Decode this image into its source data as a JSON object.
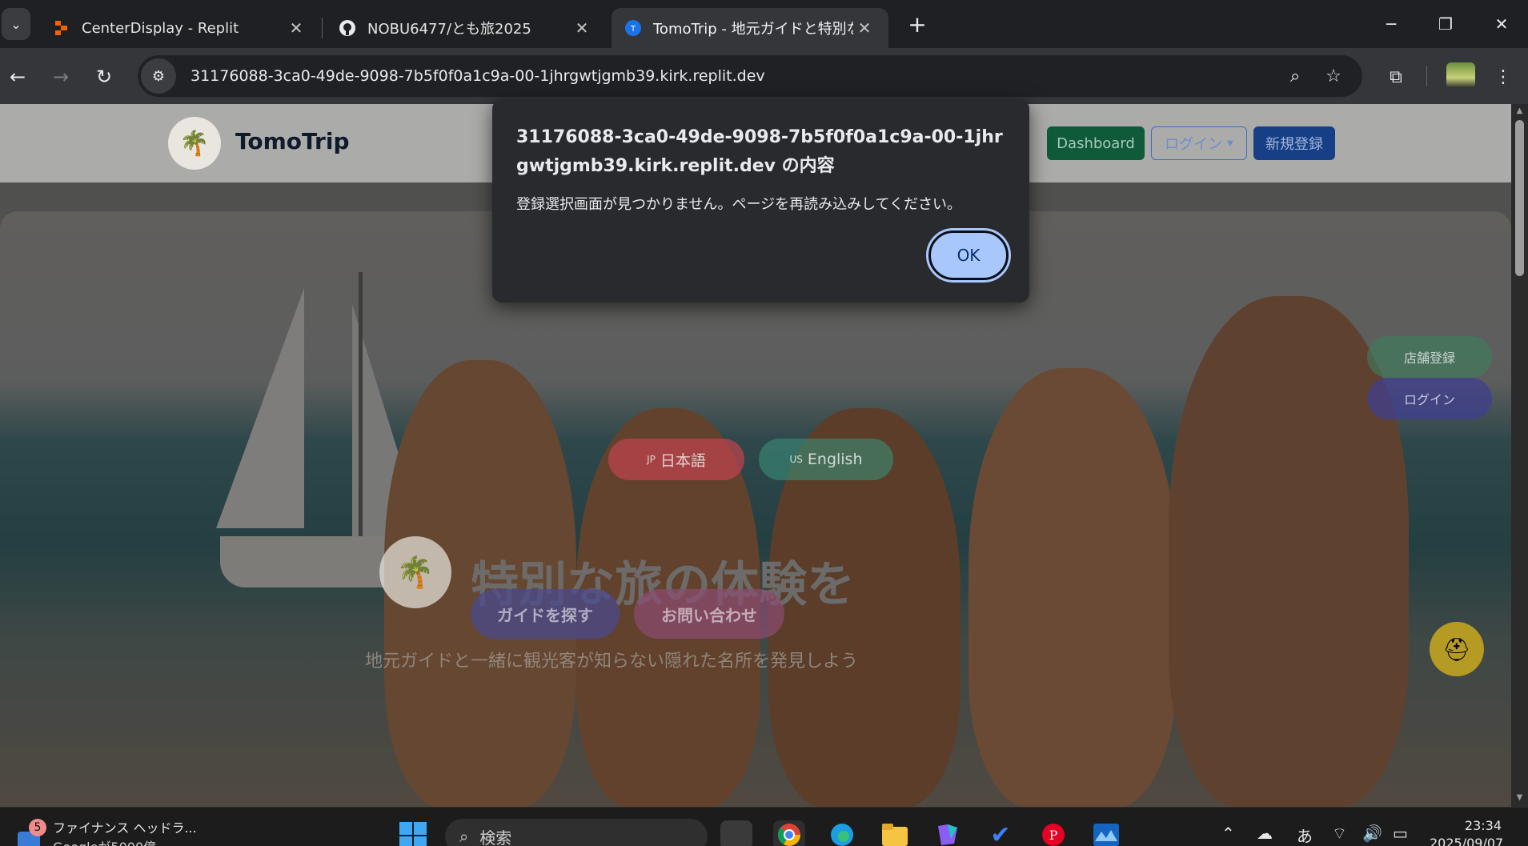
{
  "browser": {
    "tabs": [
      {
        "title": "CenterDisplay - Replit",
        "icon": "replit-icon"
      },
      {
        "title": "NOBU6477/とも旅2025",
        "icon": "github-icon"
      },
      {
        "title": "TomoTrip - 地元ガイドと特別な旅",
        "icon": "tomotrip-icon"
      }
    ],
    "new_tab": "+",
    "close": "✕",
    "url": "31176088-3ca0-49de-9098-7b5f0f0a1c9a-00-1jhrgwtjgmb39.kirk.replit.dev"
  },
  "site": {
    "brand": "TomoTrip",
    "header_buttons": {
      "dashboard": "Dashboard",
      "login": "ログイン",
      "signup": "新規登録"
    },
    "lang": {
      "ja_flag": "JP",
      "ja": "日本語",
      "en_flag": "US",
      "en": "English"
    },
    "side": {
      "store": "店舗登録",
      "login": "ログイン"
    },
    "hero": {
      "title": "特別な旅の体験を",
      "subtitle": "地元ガイドと一緒に観光客が知らない隠れた名所を発見しよう",
      "cta_find": "ガイドを探す",
      "cta_contact": "お問い合わせ"
    },
    "colors": {
      "dashboard": "#157347",
      "login_border": "#3d6fc4",
      "signup": "#1d4fa8",
      "ja": "#c2434f",
      "en": "#3a8d77",
      "store": "#3f7c5c",
      "side_login": "#3f3f8f",
      "find": "#4b4a8c",
      "contact": "#8c4c72"
    }
  },
  "dialog": {
    "title": "31176088-3ca0-49de-9098-7b5f0f0a1c9a-00-1jhrgwtjgmb39.kirk.replit.dev の内容",
    "message": "登録選択画面が見つかりません。ページを再読み込みしてください。",
    "ok": "OK"
  },
  "taskbar": {
    "news_badge": "5",
    "news_title": "ファイナンス ヘッドラ...",
    "news_sub": "Googleが5000億",
    "search": "検索",
    "ime": "あ",
    "time": "23:34",
    "date": "2025/09/07"
  }
}
